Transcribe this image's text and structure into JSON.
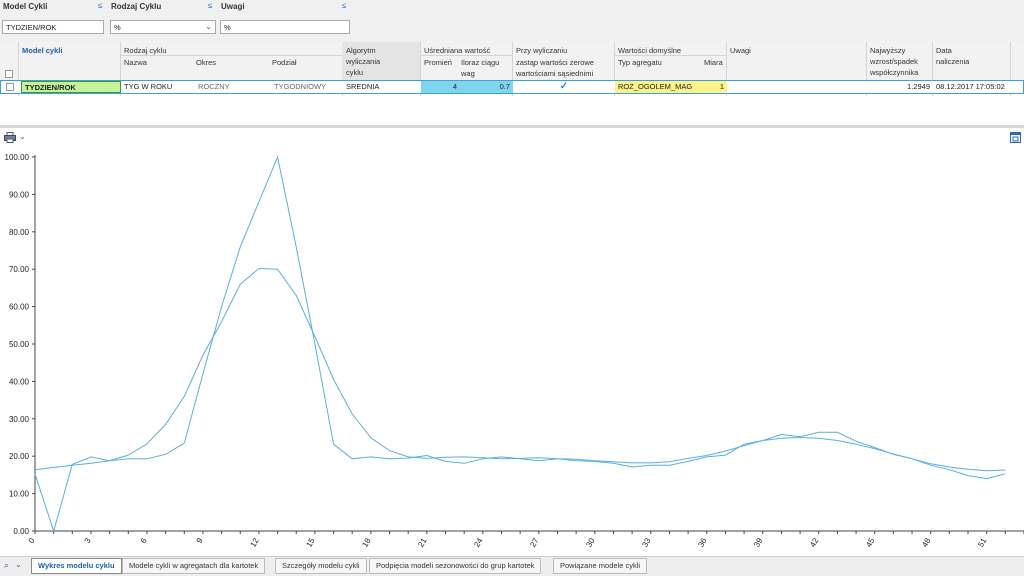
{
  "filters": [
    {
      "label": "Model Cykli",
      "value": "TYDZIEN/ROK"
    },
    {
      "label": "Rodzaj Cyklu",
      "value": "%"
    },
    {
      "label": "Uwagi",
      "value": "%"
    }
  ],
  "grid": {
    "headers": {
      "model_cykli": "Model cykli",
      "rodzaj_cyklu": "Rodzaj cyklu",
      "nazwa": "Nazwa",
      "okres": "Okres",
      "podzial": "Podział",
      "algorytm_1": "Algorytm",
      "algorytm_2": "wyliczania",
      "algorytm_3": "cyklu",
      "usredniana": "Uśredniana wartość",
      "promien": "Promień",
      "iloraz_1": "Iloraz ciągu",
      "iloraz_2": "wag",
      "przy_1": "Przy wyliczaniu",
      "przy_2": "zastąp wartości zerowe",
      "przy_3": "wartościami sąsiednimi",
      "wartosci_domyslne": "Wartości domyślne",
      "typ_agregatu": "Typ agregatu",
      "miara": "Miara",
      "uwagi": "Uwagi",
      "najwyzszy_1": "Najwyższy",
      "najwyzszy_2": "wzrost/spadek",
      "najwyzszy_3": "współczynnika",
      "data_1": "Data",
      "data_2": "naliczenia"
    },
    "row": {
      "model": "TYDZIEN/ROK",
      "nazwa": "TYG W ROKU",
      "okres": "ROCZNY",
      "podzial": "TYGODNIOWY",
      "algorytm": "SREDNIA",
      "promien": "4",
      "iloraz": "0.7",
      "zastap_checked": true,
      "typ_agregatu": "ROZ_OGOLEM_MAG",
      "miara": "1",
      "uwagi": "",
      "najwyzszy": "1.2949",
      "data": "08.12.2017 17:05:02"
    }
  },
  "tabs": [
    "Wykres modelu cyklu",
    "Modele cykli w agregatach dla kartotek",
    "Szczegóły modelu cykli",
    "Podpięcia modeli sezonowości do grup kartotek",
    "Powiązane modele cykli"
  ],
  "colors": {
    "line": "#5aaee0",
    "model_cell": "#c6f29a",
    "blue_cell": "#7fd4ee",
    "yellow_cell": "#fdf28a",
    "accent": "#1a5fa8"
  },
  "chart_data": {
    "type": "line",
    "xlim": [
      0,
      53
    ],
    "ylim": [
      0,
      100
    ],
    "yticks": [
      "0.00",
      "10.00",
      "20.00",
      "30.00",
      "40.00",
      "50.00",
      "60.00",
      "70.00",
      "80.00",
      "90.00",
      "100.00"
    ],
    "xticks": [
      "0",
      "3",
      "6",
      "9",
      "12",
      "15",
      "18",
      "21",
      "24",
      "27",
      "30",
      "33",
      "36",
      "39",
      "42",
      "45",
      "48",
      "51"
    ],
    "series": [
      {
        "values": [
          15.2,
          0.0,
          17.8,
          19.8,
          18.8,
          19.3,
          19.3,
          20.5,
          23.5,
          42,
          60,
          76,
          88,
          100,
          76,
          50,
          23.2,
          19.3,
          19.8,
          19.3,
          19.5,
          20.2,
          18.6,
          18.1,
          19.3,
          19.8,
          19.3,
          18.8,
          19.3,
          18.8,
          18.6,
          18.1,
          17.1,
          17.6,
          17.6,
          18.6,
          19.8,
          20.3,
          23.2,
          24.2,
          25.8,
          25.2,
          26.4,
          26.4,
          24.0,
          22.3,
          20.5,
          19.3,
          17.6,
          16.4,
          14.8,
          14.0,
          15.3
        ],
        "color": "#5aaee0"
      },
      {
        "values": [
          16.4,
          17.0,
          17.6,
          18.1,
          18.8,
          20.3,
          23.3,
          28.5,
          36,
          47,
          56,
          66,
          70.2,
          70.0,
          63,
          52,
          40.5,
          31.3,
          24.9,
          21.5,
          19.8,
          19.4,
          19.7,
          19.8,
          19.6,
          19.3,
          19.4,
          19.6,
          19.3,
          19.2,
          18.8,
          18.5,
          18.2,
          18.2,
          18.5,
          19.4,
          20.2,
          21.4,
          22.8,
          24.2,
          24.8,
          25.0,
          24.8,
          24.2,
          23.2,
          22.0,
          20.6,
          19.3,
          18.0,
          17.1,
          16.5,
          16.1,
          16.3
        ],
        "color": "#5aaee0"
      }
    ]
  }
}
